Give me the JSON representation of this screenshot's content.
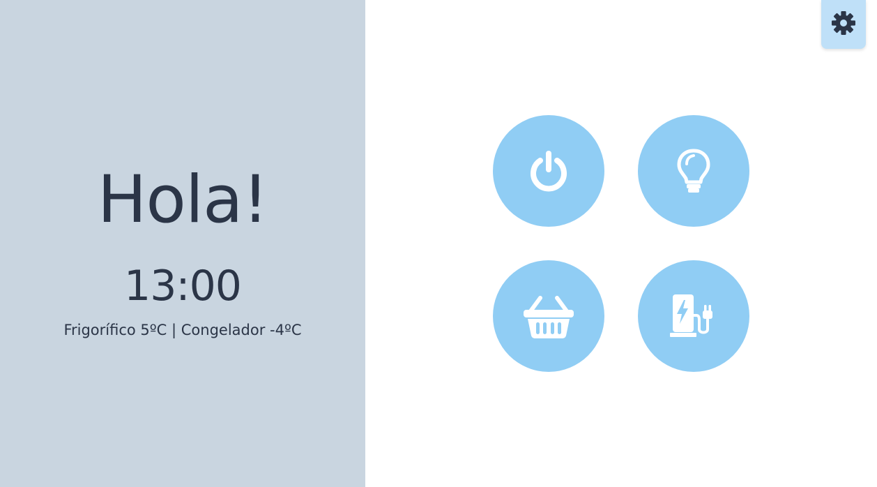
{
  "greeting": "Hola!",
  "time": "13:00",
  "temperatures": "Frigorífico 5ºC | Congelador -4ºC",
  "settings": {
    "icon": "gear-icon"
  },
  "tiles": [
    {
      "name": "power",
      "icon": "power-icon"
    },
    {
      "name": "light",
      "icon": "lightbulb-icon"
    },
    {
      "name": "shopping",
      "icon": "shopping-basket-icon"
    },
    {
      "name": "charging",
      "icon": "ev-charger-icon"
    }
  ],
  "colors": {
    "left_panel": "#c9d5e0",
    "text": "#2b3547",
    "tile": "#90cdf4",
    "settings_button": "#bfe0f8",
    "icon": "#ffffff"
  }
}
